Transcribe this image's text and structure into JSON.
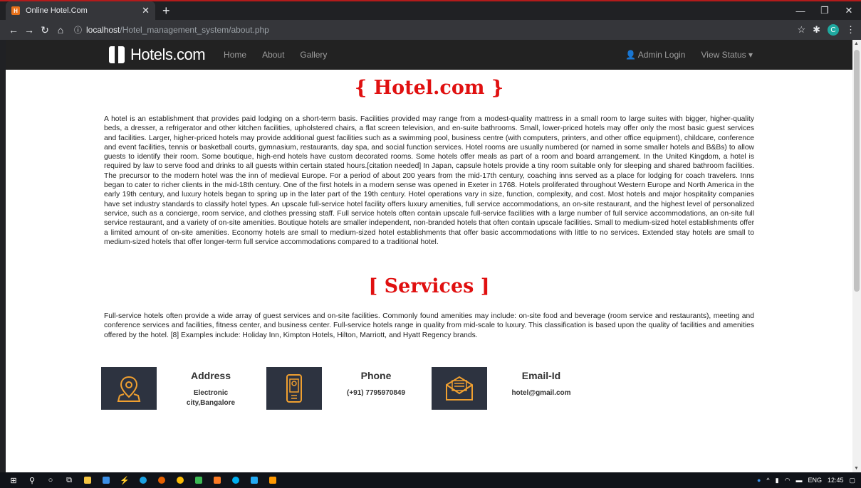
{
  "browser": {
    "tab_title": "Online Hotel.Com",
    "url_host": "localhost",
    "url_path": "/Hotel_management_system/about.php",
    "profile_initial": "C"
  },
  "navbar": {
    "brand": "Hotels.com",
    "links": [
      "Home",
      "About",
      "Gallery"
    ],
    "admin_login": "Admin Login",
    "view_status": "View Status ▾"
  },
  "about": {
    "heading": "{ Hotel.com }",
    "text": "A hotel is an establishment that provides paid lodging on a short-term basis. Facilities provided may range from a modest-quality mattress in a small room to large suites with bigger, higher-quality beds, a dresser, a refrigerator and other kitchen facilities, upholstered chairs, a flat screen television, and en-suite bathrooms. Small, lower-priced hotels may offer only the most basic guest services and facilities. Larger, higher-priced hotels may provide additional guest facilities such as a swimming pool, business centre (with computers, printers, and other office equipment), childcare, conference and event facilities, tennis or basketball courts, gymnasium, restaurants, day spa, and social function services. Hotel rooms are usually numbered (or named in some smaller hotels and B&Bs) to allow guests to identify their room. Some boutique, high-end hotels have custom decorated rooms. Some hotels offer meals as part of a room and board arrangement. In the United Kingdom, a hotel is required by law to serve food and drinks to all guests within certain stated hours.[citation needed] In Japan, capsule hotels provide a tiny room suitable only for sleeping and shared bathroom facilities. The precursor to the modern hotel was the inn of medieval Europe. For a period of about 200 years from the mid-17th century, coaching inns served as a place for lodging for coach travelers. Inns began to cater to richer clients in the mid-18th century. One of the first hotels in a modern sense was opened in Exeter in 1768. Hotels proliferated throughout Western Europe and North America in the early 19th century, and luxury hotels began to spring up in the later part of the 19th century. Hotel operations vary in size, function, complexity, and cost. Most hotels and major hospitality companies have set industry standards to classify hotel types. An upscale full-service hotel facility offers luxury amenities, full service accommodations, an on-site restaurant, and the highest level of personalized service, such as a concierge, room service, and clothes pressing staff. Full service hotels often contain upscale full-service facilities with a large number of full service accommodations, an on-site full service restaurant, and a variety of on-site amenities. Boutique hotels are smaller independent, non-branded hotels that often contain upscale facilities. Small to medium-sized hotel establishments offer a limited amount of on-site amenities. Economy hotels are small to medium-sized hotel establishments that offer basic accommodations with little to no services. Extended stay hotels are small to medium-sized hotels that offer longer-term full service accommodations compared to a traditional hotel."
  },
  "services": {
    "heading": "[ Services ]",
    "text": "Full-service hotels often provide a wide array of guest services and on-site facilities. Commonly found amenities may include: on-site food and beverage (room service and restaurants), meeting and conference services and facilities, fitness center, and business center. Full-service hotels range in quality from mid-scale to luxury. This classification is based upon the quality of facilities and amenities offered by the hotel. [8] Examples include: Holiday Inn, Kimpton Hotels, Hilton, Marriott, and Hyatt Regency brands."
  },
  "contacts": {
    "address_title": "Address",
    "address_line1": "Electronic",
    "address_line2": "city,Bangalore",
    "phone_title": "Phone",
    "phone_value": "(+91) 7795970849",
    "email_title": "Email-Id",
    "email_value": "hotel@gmail.com"
  },
  "taskbar": {
    "lang": "ENG",
    "time": "12:45"
  },
  "colors": {
    "heading_red": "#e01010",
    "navbar_bg": "#222222",
    "icon_box_bg": "#2d3340",
    "icon_orange": "#f0a030"
  },
  "icons": [
    "location-pin-icon",
    "mobile-phone-icon",
    "envelope-icon"
  ]
}
